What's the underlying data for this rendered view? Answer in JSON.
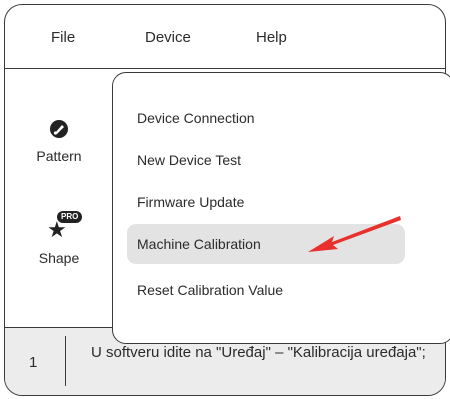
{
  "menubar": {
    "items": [
      "File",
      "Device",
      "Help"
    ]
  },
  "sidebar": {
    "pattern": {
      "label": "Pattern",
      "icon": "brush-icon"
    },
    "shape": {
      "label": "Shape",
      "icon": "star-icon",
      "badge": "PRO"
    }
  },
  "device_menu": {
    "items": [
      "Device Connection",
      "New Device Test",
      "Firmware Update",
      "Machine Calibration",
      "Reset Calibration Value"
    ],
    "highlighted": "Machine Calibration"
  },
  "pointer": {
    "icon": "red-arrow-icon",
    "color": "#e8302c"
  },
  "instruction": {
    "step": "1",
    "text": "U softveru idite na \"Uređaj\" – \"Kalibracija uređaja\";"
  },
  "colors": {
    "highlight": "#e3e3e3",
    "footer": "#ececec",
    "border": "#3a3a3a"
  }
}
